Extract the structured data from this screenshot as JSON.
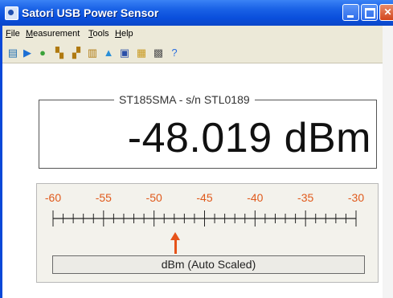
{
  "window": {
    "title": "Satori USB Power Sensor",
    "min_label": "",
    "max_label": "",
    "close_label": "✕"
  },
  "menu": {
    "file": {
      "hotkey": "F",
      "rest": "ile"
    },
    "measurement": {
      "hotkey": "M",
      "rest": "easurement"
    },
    "tools": {
      "hotkey": "T",
      "rest": "ools"
    },
    "help": {
      "hotkey": "H",
      "rest": "elp"
    }
  },
  "toolbar": {
    "icons": [
      {
        "name": "connect-icon",
        "glyph": "▤",
        "color": "#1f6fb2"
      },
      {
        "name": "play-icon",
        "glyph": "▶",
        "color": "#1d6fd3"
      },
      {
        "name": "zero-icon",
        "glyph": "●",
        "color": "#3aa23a"
      },
      {
        "name": "frequency-icon",
        "glyph": "▚",
        "color": "#b07a10"
      },
      {
        "name": "average-icon",
        "glyph": "▞",
        "color": "#b07a10"
      },
      {
        "name": "offset-icon",
        "glyph": "▥",
        "color": "#b07a10"
      },
      {
        "name": "chart-icon",
        "glyph": "▲",
        "color": "#2a8fd8"
      },
      {
        "name": "save-icon",
        "glyph": "▣",
        "color": "#2b4fa8"
      },
      {
        "name": "export-icon",
        "glyph": "▦",
        "color": "#c99a22"
      },
      {
        "name": "print-icon",
        "glyph": "▩",
        "color": "#555555"
      },
      {
        "name": "help-icon",
        "glyph": "?",
        "color": "#2a6ee0"
      }
    ]
  },
  "meter": {
    "caption": "ST185SMA - s/n STL0189",
    "reading": "-48.019 dBm"
  },
  "scale": {
    "labels": [
      "-60",
      "-55",
      "-50",
      "-45",
      "-40",
      "-35",
      "-30"
    ],
    "pointer_value": -48.019,
    "unit_label": "dBm (Auto Scaled)",
    "accent_color": "#e05a1c"
  }
}
